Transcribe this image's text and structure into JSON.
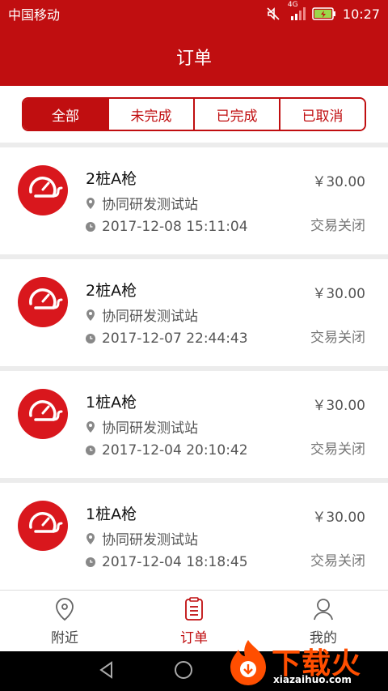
{
  "status_bar": {
    "carrier": "中国移动",
    "network": "4G",
    "time": "10:27"
  },
  "header": {
    "title": "订单"
  },
  "filter_tabs": [
    {
      "label": "全部",
      "active": true
    },
    {
      "label": "未完成",
      "active": false
    },
    {
      "label": "已完成",
      "active": false
    },
    {
      "label": "已取消",
      "active": false
    }
  ],
  "orders": [
    {
      "name": "2桩A枪",
      "station": "协同研发测试站",
      "time": "2017-12-08 15:11:04",
      "price": "￥30.00",
      "status": "交易关闭"
    },
    {
      "name": "2桩A枪",
      "station": "协同研发测试站",
      "time": "2017-12-07 22:44:43",
      "price": "￥30.00",
      "status": "交易关闭"
    },
    {
      "name": "1桩A枪",
      "station": "协同研发测试站",
      "time": "2017-12-04 20:10:42",
      "price": "￥30.00",
      "status": "交易关闭"
    },
    {
      "name": "1桩A枪",
      "station": "协同研发测试站",
      "time": "2017-12-04 18:18:45",
      "price": "￥30.00",
      "status": "交易关闭"
    }
  ],
  "tab_bar": [
    {
      "label": "附近",
      "icon": "location-pin-icon",
      "active": false
    },
    {
      "label": "订单",
      "icon": "order-list-icon",
      "active": true
    },
    {
      "label": "我的",
      "icon": "user-icon",
      "active": false
    }
  ],
  "watermark": {
    "text": "下载火",
    "url": "xiazaihuo.com"
  },
  "colors": {
    "brand_red": "#c00e10",
    "watermark_orange": "#ff4e00"
  }
}
